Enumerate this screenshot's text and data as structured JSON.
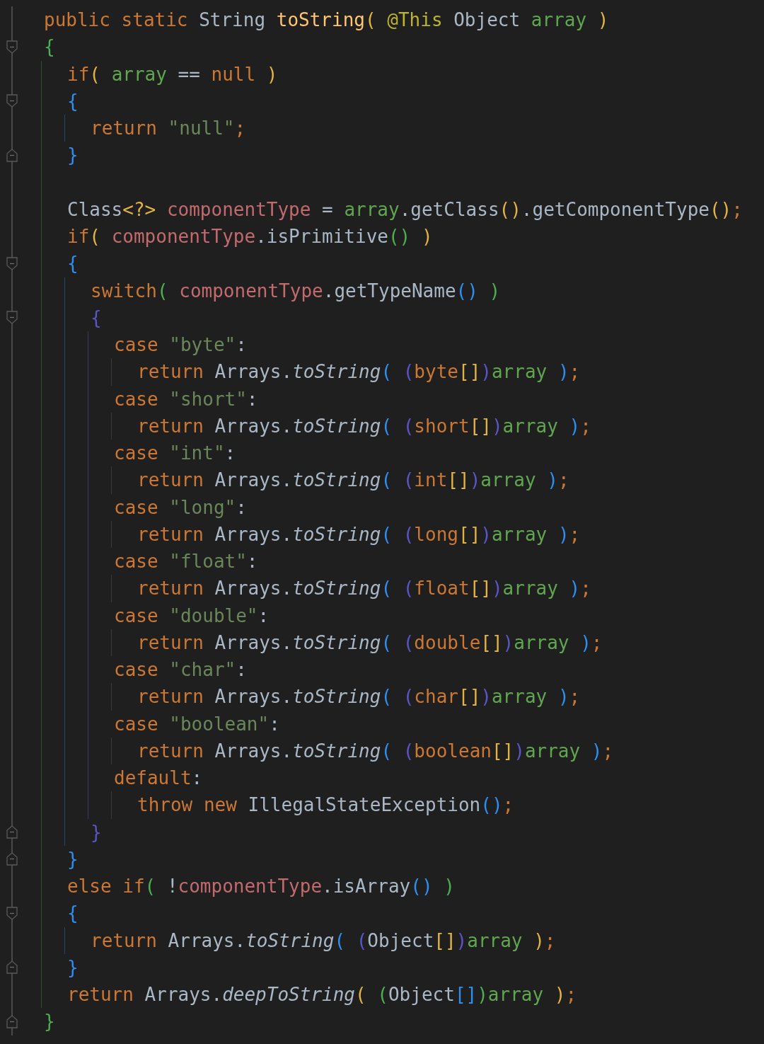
{
  "editor": {
    "lines": [
      {
        "kind": "code",
        "tokens": [
          {
            "kind": "kw",
            "text": "public static "
          },
          {
            "kind": "plain",
            "text": "String "
          },
          {
            "kind": "decl",
            "text": "toString"
          },
          {
            "kind": "bracket",
            "text": "( ",
            "color": "#e3b341"
          },
          {
            "kind": "anno",
            "text": "@This "
          },
          {
            "kind": "plain",
            "text": "Object "
          },
          {
            "kind": "param",
            "text": "array "
          },
          {
            "kind": "bracket",
            "text": ")",
            "color": "#e3b341"
          }
        ]
      },
      {
        "kind": "block-start",
        "tokens": [
          {
            "kind": "bracket",
            "text": "{",
            "color": "#4caf50"
          }
        ],
        "children": [
          {
            "kind": "code",
            "tokens": [
              {
                "kind": "kw",
                "text": "if"
              },
              {
                "kind": "bracket",
                "text": "( ",
                "color": "#e3b341"
              },
              {
                "kind": "param",
                "text": "array"
              },
              {
                "kind": "plain",
                "text": " == "
              },
              {
                "kind": "kw",
                "text": "null "
              },
              {
                "kind": "bracket",
                "text": ")",
                "color": "#e3b341"
              }
            ]
          },
          {
            "kind": "block-start",
            "tokens": [
              {
                "kind": "bracket",
                "text": "{",
                "color": "#2f8ff0"
              }
            ],
            "children": [
              {
                "kind": "code",
                "tokens": [
                  {
                    "kind": "kw",
                    "text": "return "
                  },
                  {
                    "kind": "str",
                    "text": "\"null\""
                  },
                  {
                    "kind": "kw",
                    "text": ";"
                  }
                ]
              }
            ]
          },
          {
            "kind": "block-end",
            "tokens": [
              {
                "kind": "bracket",
                "text": "}",
                "color": "#2f8ff0"
              }
            ]
          },
          {
            "kind": "blank"
          },
          {
            "kind": "code",
            "tokens": [
              {
                "kind": "plain",
                "text": "Class"
              },
              {
                "kind": "bracket",
                "text": "<?>",
                "color": "#e3b341"
              },
              {
                "kind": "field",
                "text": " componentType"
              },
              {
                "kind": "plain",
                "text": " = "
              },
              {
                "kind": "param",
                "text": "array"
              },
              {
                "kind": "plain",
                "text": ".getClass"
              },
              {
                "kind": "bracket",
                "text": "()",
                "color": "#e3b341"
              },
              {
                "kind": "plain",
                "text": ".getComponentType"
              },
              {
                "kind": "bracket",
                "text": "()",
                "color": "#e3b341"
              },
              {
                "kind": "kw",
                "text": ";"
              }
            ]
          },
          {
            "kind": "code",
            "tokens": [
              {
                "kind": "kw",
                "text": "if"
              },
              {
                "kind": "bracket",
                "text": "( ",
                "color": "#e3b341"
              },
              {
                "kind": "field",
                "text": "componentType"
              },
              {
                "kind": "plain",
                "text": ".isPrimitive"
              },
              {
                "kind": "bracket",
                "text": "() ",
                "color": "#4caf50"
              },
              {
                "kind": "bracket",
                "text": ")",
                "color": "#e3b341"
              }
            ]
          },
          {
            "kind": "block-start",
            "tokens": [
              {
                "kind": "bracket",
                "text": "{",
                "color": "#2f8ff0"
              }
            ],
            "children": [
              {
                "kind": "code",
                "tokens": [
                  {
                    "kind": "kw",
                    "text": "switch"
                  },
                  {
                    "kind": "bracket",
                    "text": "( ",
                    "color": "#4caf50"
                  },
                  {
                    "kind": "field",
                    "text": "componentType"
                  },
                  {
                    "kind": "plain",
                    "text": ".getTypeName"
                  },
                  {
                    "kind": "bracket",
                    "text": "() ",
                    "color": "#2f8ff0"
                  },
                  {
                    "kind": "bracket",
                    "text": ")",
                    "color": "#4caf50"
                  }
                ]
              },
              {
                "kind": "block-start",
                "tokens": [
                  {
                    "kind": "bracket",
                    "text": "{",
                    "color": "#5a55c8"
                  }
                ],
                "children": [
                  {
                    "kind": "code",
                    "tokens": [
                      {
                        "kind": "kw",
                        "text": "case "
                      },
                      {
                        "kind": "str",
                        "text": "\"byte\""
                      },
                      {
                        "kind": "plain",
                        "text": ":"
                      }
                    ],
                    "children": [
                      {
                        "kind": "code",
                        "tokens": [
                          {
                            "kind": "kw",
                            "text": "return "
                          },
                          {
                            "kind": "plain",
                            "text": "Arrays."
                          },
                          {
                            "kind": "call",
                            "text": "toString"
                          },
                          {
                            "kind": "bracket",
                            "text": "( ",
                            "color": "#2f8ff0"
                          },
                          {
                            "kind": "bracket",
                            "text": "(",
                            "color": "#5a55c8"
                          },
                          {
                            "kind": "kw",
                            "text": "byte"
                          },
                          {
                            "kind": "bracket",
                            "text": "[]",
                            "color": "#e3b341"
                          },
                          {
                            "kind": "bracket",
                            "text": ")",
                            "color": "#5a55c8"
                          },
                          {
                            "kind": "param",
                            "text": "array "
                          },
                          {
                            "kind": "bracket",
                            "text": ")",
                            "color": "#2f8ff0"
                          },
                          {
                            "kind": "kw",
                            "text": ";"
                          }
                        ]
                      }
                    ]
                  },
                  {
                    "kind": "code",
                    "tokens": [
                      {
                        "kind": "kw",
                        "text": "case "
                      },
                      {
                        "kind": "str",
                        "text": "\"short\""
                      },
                      {
                        "kind": "plain",
                        "text": ":"
                      }
                    ],
                    "children": [
                      {
                        "kind": "code",
                        "tokens": [
                          {
                            "kind": "kw",
                            "text": "return "
                          },
                          {
                            "kind": "plain",
                            "text": "Arrays."
                          },
                          {
                            "kind": "call",
                            "text": "toString"
                          },
                          {
                            "kind": "bracket",
                            "text": "( ",
                            "color": "#2f8ff0"
                          },
                          {
                            "kind": "bracket",
                            "text": "(",
                            "color": "#5a55c8"
                          },
                          {
                            "kind": "kw",
                            "text": "short"
                          },
                          {
                            "kind": "bracket",
                            "text": "[]",
                            "color": "#e3b341"
                          },
                          {
                            "kind": "bracket",
                            "text": ")",
                            "color": "#5a55c8"
                          },
                          {
                            "kind": "param",
                            "text": "array "
                          },
                          {
                            "kind": "bracket",
                            "text": ")",
                            "color": "#2f8ff0"
                          },
                          {
                            "kind": "kw",
                            "text": ";"
                          }
                        ]
                      }
                    ]
                  },
                  {
                    "kind": "code",
                    "tokens": [
                      {
                        "kind": "kw",
                        "text": "case "
                      },
                      {
                        "kind": "str",
                        "text": "\"int\""
                      },
                      {
                        "kind": "plain",
                        "text": ":"
                      }
                    ],
                    "children": [
                      {
                        "kind": "code",
                        "tokens": [
                          {
                            "kind": "kw",
                            "text": "return "
                          },
                          {
                            "kind": "plain",
                            "text": "Arrays."
                          },
                          {
                            "kind": "call",
                            "text": "toString"
                          },
                          {
                            "kind": "bracket",
                            "text": "( ",
                            "color": "#2f8ff0"
                          },
                          {
                            "kind": "bracket",
                            "text": "(",
                            "color": "#5a55c8"
                          },
                          {
                            "kind": "kw",
                            "text": "int"
                          },
                          {
                            "kind": "bracket",
                            "text": "[]",
                            "color": "#e3b341"
                          },
                          {
                            "kind": "bracket",
                            "text": ")",
                            "color": "#5a55c8"
                          },
                          {
                            "kind": "param",
                            "text": "array "
                          },
                          {
                            "kind": "bracket",
                            "text": ")",
                            "color": "#2f8ff0"
                          },
                          {
                            "kind": "kw",
                            "text": ";"
                          }
                        ]
                      }
                    ]
                  },
                  {
                    "kind": "code",
                    "tokens": [
                      {
                        "kind": "kw",
                        "text": "case "
                      },
                      {
                        "kind": "str",
                        "text": "\"long\""
                      },
                      {
                        "kind": "plain",
                        "text": ":"
                      }
                    ],
                    "children": [
                      {
                        "kind": "code",
                        "tokens": [
                          {
                            "kind": "kw",
                            "text": "return "
                          },
                          {
                            "kind": "plain",
                            "text": "Arrays."
                          },
                          {
                            "kind": "call",
                            "text": "toString"
                          },
                          {
                            "kind": "bracket",
                            "text": "( ",
                            "color": "#2f8ff0"
                          },
                          {
                            "kind": "bracket",
                            "text": "(",
                            "color": "#5a55c8"
                          },
                          {
                            "kind": "kw",
                            "text": "long"
                          },
                          {
                            "kind": "bracket",
                            "text": "[]",
                            "color": "#e3b341"
                          },
                          {
                            "kind": "bracket",
                            "text": ")",
                            "color": "#5a55c8"
                          },
                          {
                            "kind": "param",
                            "text": "array "
                          },
                          {
                            "kind": "bracket",
                            "text": ")",
                            "color": "#2f8ff0"
                          },
                          {
                            "kind": "kw",
                            "text": ";"
                          }
                        ]
                      }
                    ]
                  },
                  {
                    "kind": "code",
                    "tokens": [
                      {
                        "kind": "kw",
                        "text": "case "
                      },
                      {
                        "kind": "str",
                        "text": "\"float\""
                      },
                      {
                        "kind": "plain",
                        "text": ":"
                      }
                    ],
                    "children": [
                      {
                        "kind": "code",
                        "tokens": [
                          {
                            "kind": "kw",
                            "text": "return "
                          },
                          {
                            "kind": "plain",
                            "text": "Arrays."
                          },
                          {
                            "kind": "call",
                            "text": "toString"
                          },
                          {
                            "kind": "bracket",
                            "text": "( ",
                            "color": "#2f8ff0"
                          },
                          {
                            "kind": "bracket",
                            "text": "(",
                            "color": "#5a55c8"
                          },
                          {
                            "kind": "kw",
                            "text": "float"
                          },
                          {
                            "kind": "bracket",
                            "text": "[]",
                            "color": "#e3b341"
                          },
                          {
                            "kind": "bracket",
                            "text": ")",
                            "color": "#5a55c8"
                          },
                          {
                            "kind": "param",
                            "text": "array "
                          },
                          {
                            "kind": "bracket",
                            "text": ")",
                            "color": "#2f8ff0"
                          },
                          {
                            "kind": "kw",
                            "text": ";"
                          }
                        ]
                      }
                    ]
                  },
                  {
                    "kind": "code",
                    "tokens": [
                      {
                        "kind": "kw",
                        "text": "case "
                      },
                      {
                        "kind": "str",
                        "text": "\"double\""
                      },
                      {
                        "kind": "plain",
                        "text": ":"
                      }
                    ],
                    "children": [
                      {
                        "kind": "code",
                        "tokens": [
                          {
                            "kind": "kw",
                            "text": "return "
                          },
                          {
                            "kind": "plain",
                            "text": "Arrays."
                          },
                          {
                            "kind": "call",
                            "text": "toString"
                          },
                          {
                            "kind": "bracket",
                            "text": "( ",
                            "color": "#2f8ff0"
                          },
                          {
                            "kind": "bracket",
                            "text": "(",
                            "color": "#5a55c8"
                          },
                          {
                            "kind": "kw",
                            "text": "double"
                          },
                          {
                            "kind": "bracket",
                            "text": "[]",
                            "color": "#e3b341"
                          },
                          {
                            "kind": "bracket",
                            "text": ")",
                            "color": "#5a55c8"
                          },
                          {
                            "kind": "param",
                            "text": "array "
                          },
                          {
                            "kind": "bracket",
                            "text": ")",
                            "color": "#2f8ff0"
                          },
                          {
                            "kind": "kw",
                            "text": ";"
                          }
                        ]
                      }
                    ]
                  },
                  {
                    "kind": "code",
                    "tokens": [
                      {
                        "kind": "kw",
                        "text": "case "
                      },
                      {
                        "kind": "str",
                        "text": "\"char\""
                      },
                      {
                        "kind": "plain",
                        "text": ":"
                      }
                    ],
                    "children": [
                      {
                        "kind": "code",
                        "tokens": [
                          {
                            "kind": "kw",
                            "text": "return "
                          },
                          {
                            "kind": "plain",
                            "text": "Arrays."
                          },
                          {
                            "kind": "call",
                            "text": "toString"
                          },
                          {
                            "kind": "bracket",
                            "text": "( ",
                            "color": "#2f8ff0"
                          },
                          {
                            "kind": "bracket",
                            "text": "(",
                            "color": "#5a55c8"
                          },
                          {
                            "kind": "kw",
                            "text": "char"
                          },
                          {
                            "kind": "bracket",
                            "text": "[]",
                            "color": "#e3b341"
                          },
                          {
                            "kind": "bracket",
                            "text": ")",
                            "color": "#5a55c8"
                          },
                          {
                            "kind": "param",
                            "text": "array "
                          },
                          {
                            "kind": "bracket",
                            "text": ")",
                            "color": "#2f8ff0"
                          },
                          {
                            "kind": "kw",
                            "text": ";"
                          }
                        ]
                      }
                    ]
                  },
                  {
                    "kind": "code",
                    "tokens": [
                      {
                        "kind": "kw",
                        "text": "case "
                      },
                      {
                        "kind": "str",
                        "text": "\"boolean\""
                      },
                      {
                        "kind": "plain",
                        "text": ":"
                      }
                    ],
                    "children": [
                      {
                        "kind": "code",
                        "tokens": [
                          {
                            "kind": "kw",
                            "text": "return "
                          },
                          {
                            "kind": "plain",
                            "text": "Arrays."
                          },
                          {
                            "kind": "call",
                            "text": "toString"
                          },
                          {
                            "kind": "bracket",
                            "text": "( ",
                            "color": "#2f8ff0"
                          },
                          {
                            "kind": "bracket",
                            "text": "(",
                            "color": "#5a55c8"
                          },
                          {
                            "kind": "kw",
                            "text": "boolean"
                          },
                          {
                            "kind": "bracket",
                            "text": "[]",
                            "color": "#e3b341"
                          },
                          {
                            "kind": "bracket",
                            "text": ")",
                            "color": "#5a55c8"
                          },
                          {
                            "kind": "param",
                            "text": "array "
                          },
                          {
                            "kind": "bracket",
                            "text": ")",
                            "color": "#2f8ff0"
                          },
                          {
                            "kind": "kw",
                            "text": ";"
                          }
                        ]
                      }
                    ]
                  },
                  {
                    "kind": "code",
                    "tokens": [
                      {
                        "kind": "kw",
                        "text": "default"
                      },
                      {
                        "kind": "plain",
                        "text": ":"
                      }
                    ],
                    "children": [
                      {
                        "kind": "code",
                        "tokens": [
                          {
                            "kind": "kw",
                            "text": "throw new "
                          },
                          {
                            "kind": "plain",
                            "text": "IllegalStateException"
                          },
                          {
                            "kind": "bracket",
                            "text": "()",
                            "color": "#2f8ff0"
                          },
                          {
                            "kind": "kw",
                            "text": ";"
                          }
                        ]
                      }
                    ]
                  }
                ]
              },
              {
                "kind": "block-end",
                "tokens": [
                  {
                    "kind": "bracket",
                    "text": "}",
                    "color": "#5a55c8"
                  }
                ]
              }
            ]
          },
          {
            "kind": "block-end",
            "tokens": [
              {
                "kind": "bracket",
                "text": "}",
                "color": "#2f8ff0"
              }
            ]
          },
          {
            "kind": "code",
            "tokens": [
              {
                "kind": "kw",
                "text": "else if"
              },
              {
                "kind": "bracket",
                "text": "( ",
                "color": "#4caf50"
              },
              {
                "kind": "plain",
                "text": "!"
              },
              {
                "kind": "field",
                "text": "componentType"
              },
              {
                "kind": "plain",
                "text": ".isArray"
              },
              {
                "kind": "bracket",
                "text": "() ",
                "color": "#2f8ff0"
              },
              {
                "kind": "bracket",
                "text": ")",
                "color": "#4caf50"
              }
            ]
          },
          {
            "kind": "block-start",
            "tokens": [
              {
                "kind": "bracket",
                "text": "{",
                "color": "#2f8ff0"
              }
            ],
            "children": [
              {
                "kind": "code",
                "tokens": [
                  {
                    "kind": "kw",
                    "text": "return "
                  },
                  {
                    "kind": "plain",
                    "text": "Arrays."
                  },
                  {
                    "kind": "call",
                    "text": "toString"
                  },
                  {
                    "kind": "bracket",
                    "text": "( ",
                    "color": "#2f8ff0"
                  },
                  {
                    "kind": "bracket",
                    "text": "(",
                    "color": "#5a55c8"
                  },
                  {
                    "kind": "plain",
                    "text": "Object"
                  },
                  {
                    "kind": "bracket",
                    "text": "[]",
                    "color": "#e3b341"
                  },
                  {
                    "kind": "bracket",
                    "text": ")",
                    "color": "#5a55c8"
                  },
                  {
                    "kind": "param",
                    "text": "array "
                  },
                  {
                    "kind": "bracket",
                    "text": ")",
                    "color": "#e3b341"
                  },
                  {
                    "kind": "kw",
                    "text": ";"
                  }
                ]
              }
            ]
          },
          {
            "kind": "block-end",
            "tokens": [
              {
                "kind": "bracket",
                "text": "}",
                "color": "#2f8ff0"
              }
            ]
          },
          {
            "kind": "code",
            "tokens": [
              {
                "kind": "kw",
                "text": "return "
              },
              {
                "kind": "plain",
                "text": "Arrays."
              },
              {
                "kind": "call",
                "text": "deepToString"
              },
              {
                "kind": "bracket",
                "text": "( ",
                "color": "#e3b341"
              },
              {
                "kind": "bracket",
                "text": "(",
                "color": "#4caf50"
              },
              {
                "kind": "plain",
                "text": "Object"
              },
              {
                "kind": "bracket",
                "text": "[]",
                "color": "#2f8ff0"
              },
              {
                "kind": "bracket",
                "text": ")",
                "color": "#4caf50"
              },
              {
                "kind": "param",
                "text": "array "
              },
              {
                "kind": "bracket",
                "text": ")",
                "color": "#e3b341"
              },
              {
                "kind": "kw",
                "text": ";"
              }
            ]
          }
        ]
      },
      {
        "kind": "block-end",
        "tokens": [
          {
            "kind": "bracket",
            "text": "}",
            "color": "#4caf50"
          }
        ]
      }
    ]
  }
}
